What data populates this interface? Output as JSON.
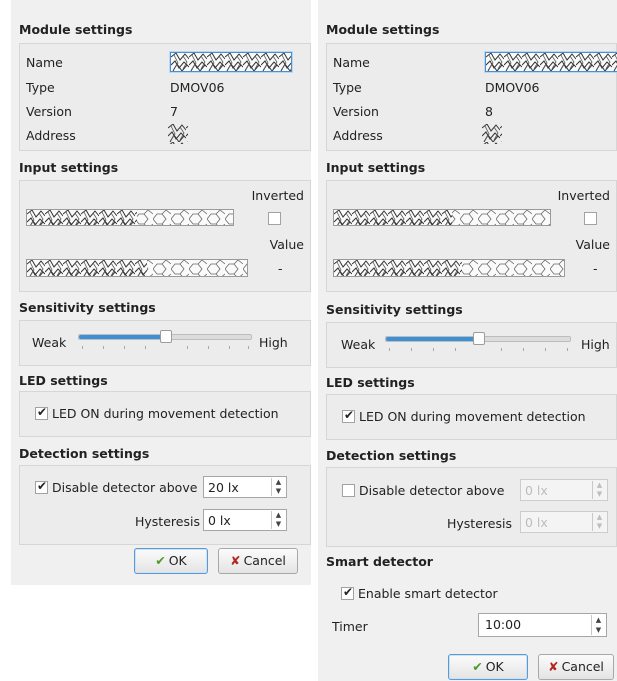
{
  "left_dialog": {
    "module_settings": {
      "title": "Module settings",
      "name_label": "Name",
      "type_label": "Type",
      "type_value": "DMOV06",
      "version_label": "Version",
      "version_value": "7",
      "address_label": "Address"
    },
    "input_settings": {
      "title": "Input settings",
      "inverted_label": "Inverted",
      "value_label": "Value",
      "value_text": "-",
      "inverted_checked": false
    },
    "sensitivity": {
      "title": "Sensitivity settings",
      "weak_label": "Weak",
      "high_label": "High",
      "level_fraction": 0.5
    },
    "led": {
      "title": "LED settings",
      "checkbox_label": "LED ON during movement detection",
      "checked": true
    },
    "detection": {
      "title": "Detection settings",
      "disable_label": "Disable detector above",
      "disable_checked": true,
      "disable_value": "20 lx",
      "hysteresis_label": "Hysteresis",
      "hysteresis_value": "0 lx"
    },
    "buttons": {
      "ok": "OK",
      "cancel": "Cancel"
    }
  },
  "right_dialog": {
    "module_settings": {
      "title": "Module settings",
      "name_label": "Name",
      "type_label": "Type",
      "type_value": "DMOV06",
      "version_label": "Version",
      "version_value": "8",
      "address_label": "Address"
    },
    "input_settings": {
      "title": "Input settings",
      "inverted_label": "Inverted",
      "value_label": "Value",
      "value_text": "-",
      "inverted_checked": false
    },
    "sensitivity": {
      "title": "Sensitivity settings",
      "weak_label": "Weak",
      "high_label": "High",
      "level_fraction": 0.5
    },
    "led": {
      "title": "LED settings",
      "checkbox_label": "LED ON during movement detection",
      "checked": true
    },
    "detection": {
      "title": "Detection settings",
      "disable_label": "Disable detector above",
      "disable_checked": false,
      "disable_value": "0 lx",
      "hysteresis_label": "Hysteresis",
      "hysteresis_value": "0 lx"
    },
    "smart": {
      "title": "Smart detector",
      "enable_label": "Enable smart detector",
      "enable_checked": true,
      "timer_label": "Timer",
      "timer_value": "10:00"
    },
    "buttons": {
      "ok": "OK",
      "cancel": "Cancel"
    }
  },
  "icons": {
    "ok": "ok-hand-icon",
    "cancel": "x-icon",
    "address": "obfuscated-address-icon",
    "checkbox": "checkmark-icon"
  },
  "colors": {
    "accent": "#3d8fd6",
    "panel": "#f0f0f0",
    "focus_border": "#4a8fd1"
  }
}
